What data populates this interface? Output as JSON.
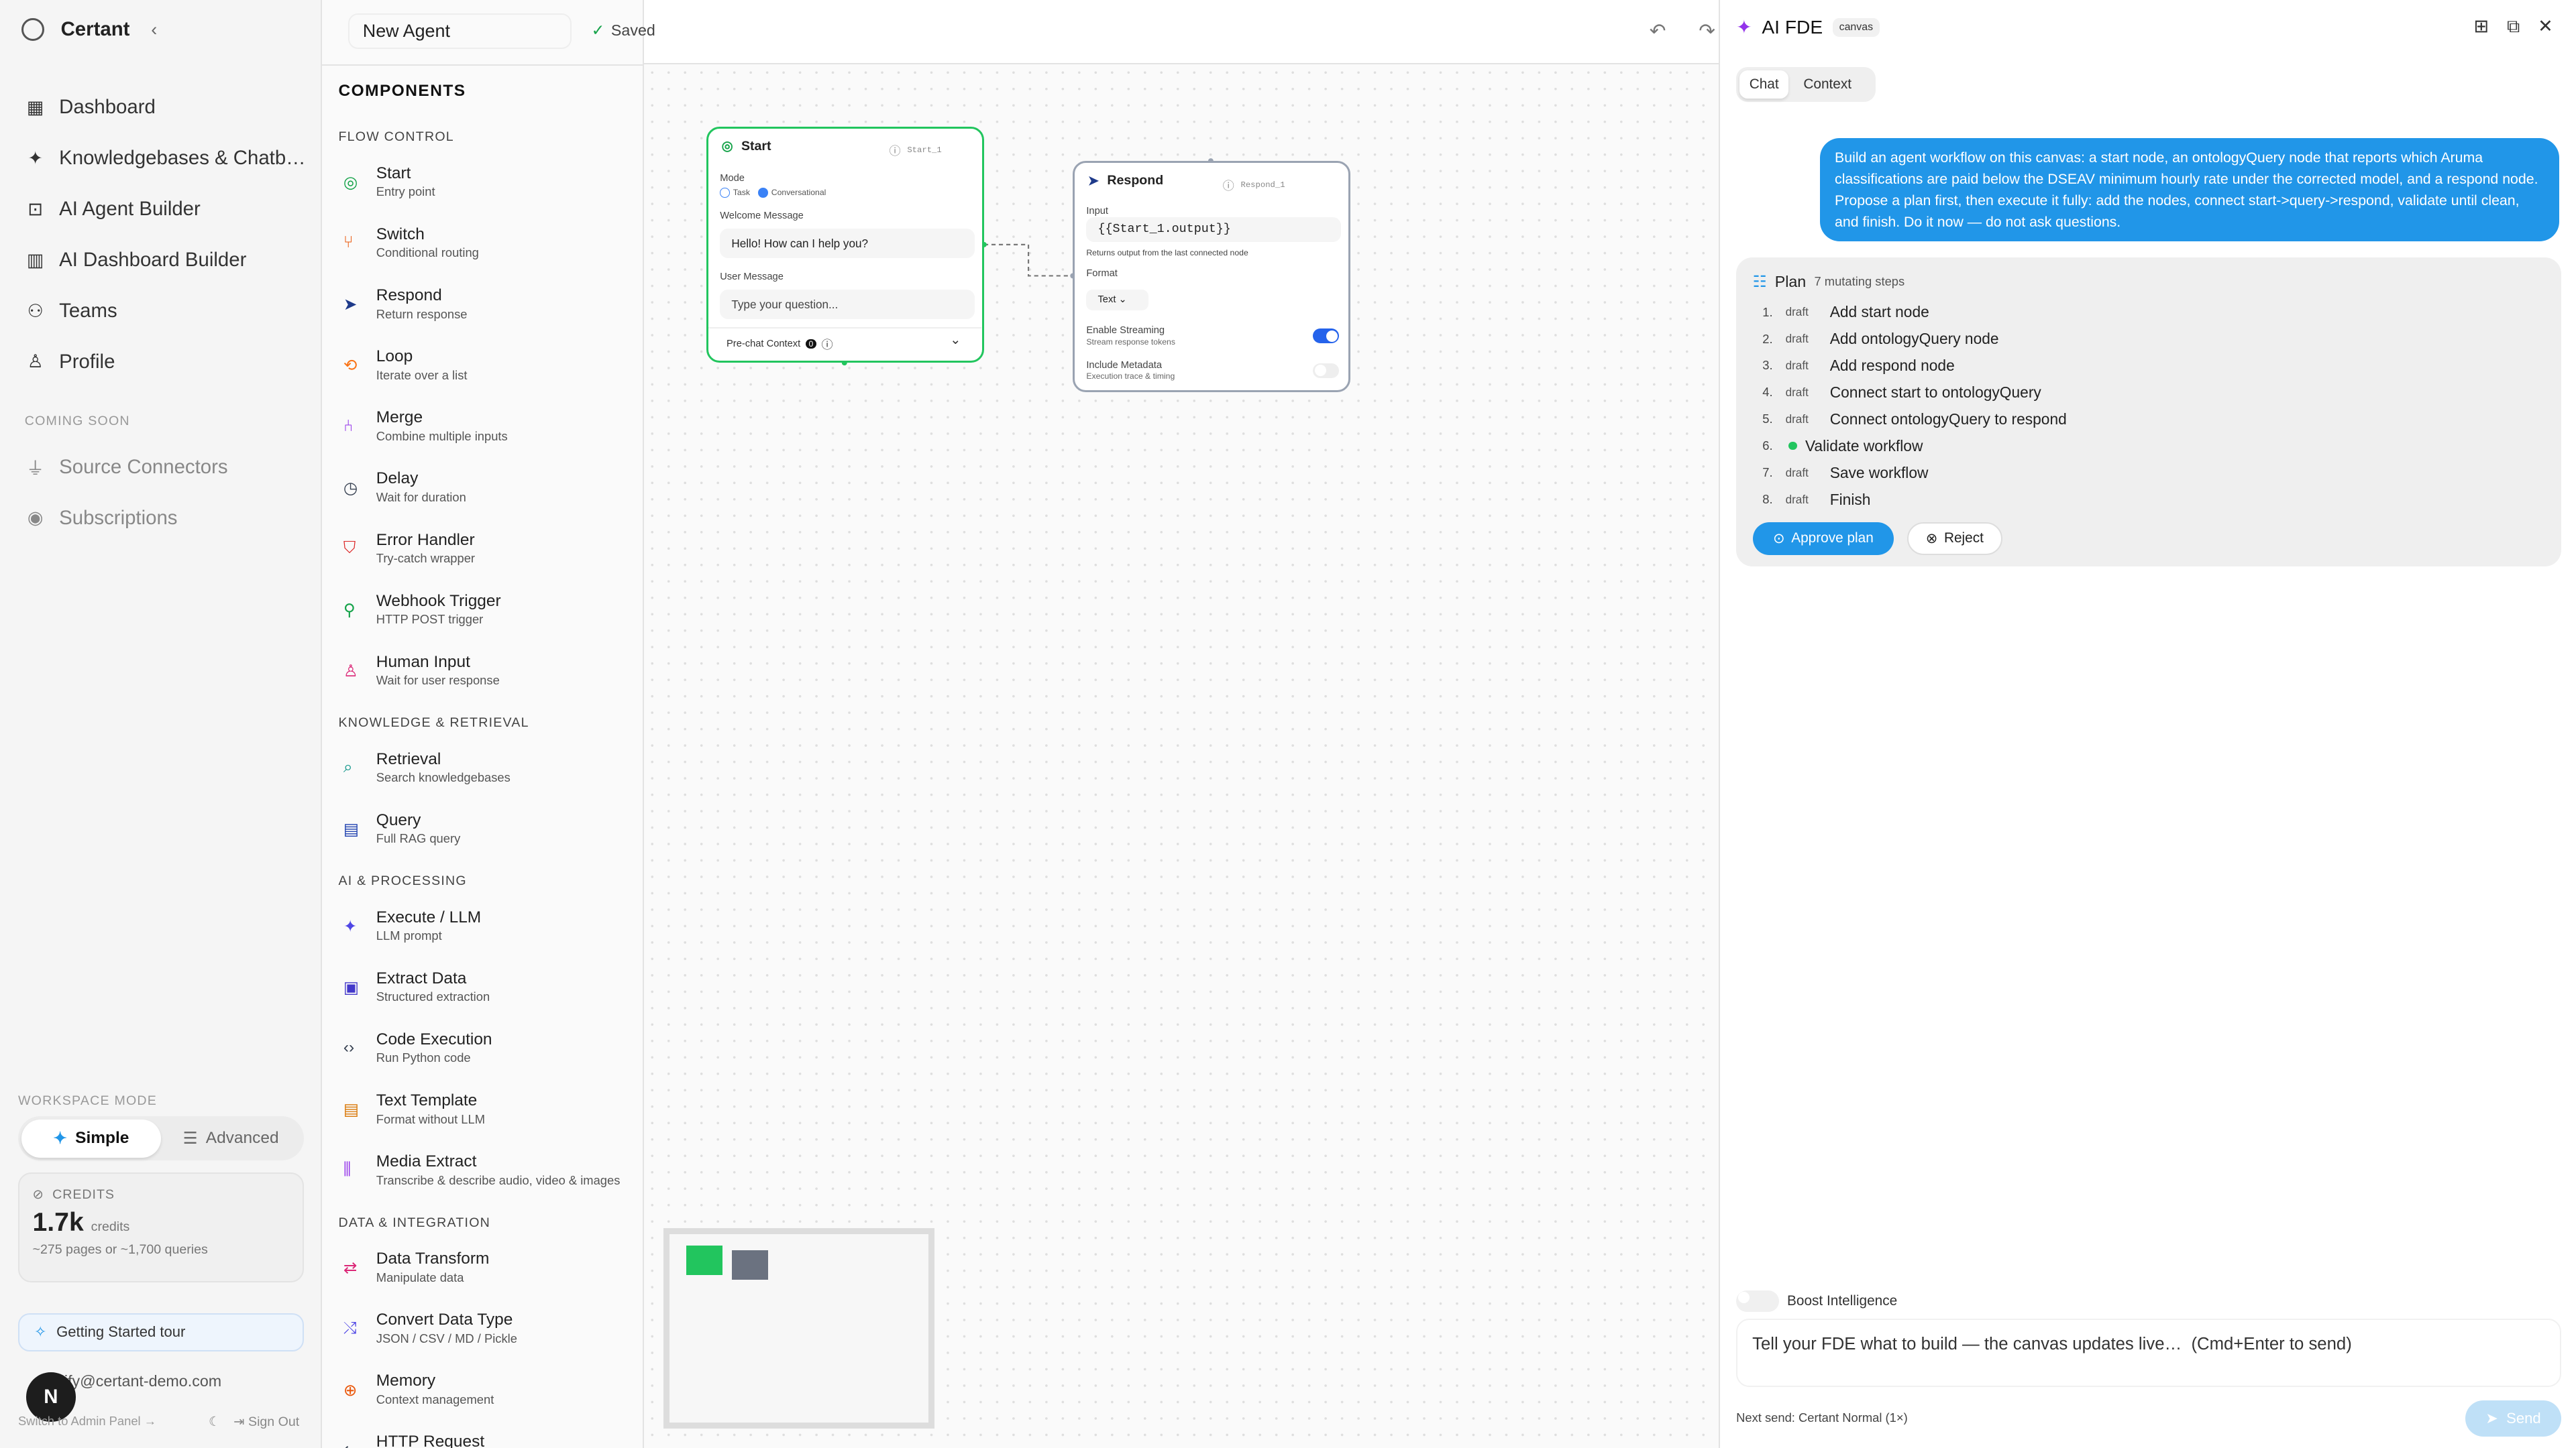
{
  "nav": {
    "brand": "Certant",
    "items": [
      {
        "label": "Dashboard",
        "icon": "dashboard-icon"
      },
      {
        "label": "Knowledgebases & Chatb…",
        "icon": "sparkle-icon"
      },
      {
        "label": "AI Agent Builder",
        "icon": "robot-icon"
      },
      {
        "label": "AI Dashboard Builder",
        "icon": "chart-icon"
      },
      {
        "label": "Teams",
        "icon": "users-icon"
      },
      {
        "label": "Profile",
        "icon": "user-icon"
      }
    ],
    "coming_soon_label": "COMING SOON",
    "coming_items": [
      {
        "label": "Source Connectors",
        "icon": "plug-icon"
      },
      {
        "label": "Subscriptions",
        "icon": "broadcast-icon"
      }
    ],
    "workspace_mode_label": "WORKSPACE MODE",
    "mode_simple": "Simple",
    "mode_advanced": "Advanced",
    "credits_label": "CREDITS",
    "credits_value": "1.7k",
    "credits_unit": "credits",
    "credits_sub": "~275 pages or ~1,700 queries",
    "tour_label": "Getting Started tour",
    "email": "rify@certant-demo.com",
    "avatar_letter": "N",
    "admin_link": "Switch to Admin Panel →",
    "signout": "Sign Out"
  },
  "components": {
    "title": "COMPONENTS",
    "sections": [
      {
        "label": "FLOW CONTROL",
        "items": [
          {
            "name": "Start",
            "desc": "Entry point",
            "color": "#16a34a"
          },
          {
            "name": "Switch",
            "desc": "Conditional routing",
            "color": "#ea580c"
          },
          {
            "name": "Respond",
            "desc": "Return response",
            "color": "#1e3a8a"
          },
          {
            "name": "Loop",
            "desc": "Iterate over a list",
            "color": "#f97316"
          },
          {
            "name": "Merge",
            "desc": "Combine multiple inputs",
            "color": "#9333ea"
          },
          {
            "name": "Delay",
            "desc": "Wait for duration",
            "color": "#374151"
          },
          {
            "name": "Error Handler",
            "desc": "Try-catch wrapper",
            "color": "#dc2626"
          },
          {
            "name": "Webhook Trigger",
            "desc": "HTTP POST trigger",
            "color": "#16a34a"
          },
          {
            "name": "Human Input",
            "desc": "Wait for user response",
            "color": "#db2777"
          }
        ]
      },
      {
        "label": "KNOWLEDGE & RETRIEVAL",
        "items": [
          {
            "name": "Retrieval",
            "desc": "Search knowledgebases",
            "color": "#0d9488"
          },
          {
            "name": "Query",
            "desc": "Full RAG query",
            "color": "#1e40af"
          }
        ]
      },
      {
        "label": "AI & PROCESSING",
        "items": [
          {
            "name": "Execute / LLM",
            "desc": "LLM prompt",
            "color": "#4f46e5"
          },
          {
            "name": "Extract Data",
            "desc": "Structured extraction",
            "color": "#4338ca"
          },
          {
            "name": "Code Execution",
            "desc": "Run Python code",
            "color": "#374151"
          },
          {
            "name": "Text Template",
            "desc": "Format without LLM",
            "color": "#d97706"
          },
          {
            "name": "Media Extract",
            "desc": "Transcribe & describe audio, video & images",
            "color": "#9333ea"
          }
        ]
      },
      {
        "label": "DATA & INTEGRATION",
        "items": [
          {
            "name": "Data Transform",
            "desc": "Manipulate data",
            "color": "#db2777"
          },
          {
            "name": "Convert Data Type",
            "desc": "JSON / CSV / MD / Pickle",
            "color": "#4f46e5"
          },
          {
            "name": "Memory",
            "desc": "Context management",
            "color": "#ea580c"
          },
          {
            "name": "HTTP Request",
            "desc": "",
            "color": "#374151"
          }
        ]
      }
    ]
  },
  "titlebar": {
    "name": "New Agent",
    "saved": "Saved"
  },
  "start_node": {
    "title": "Start",
    "id": "Start_1",
    "mode_label": "Mode",
    "mode_task": "Task",
    "mode_conv": "Conversational",
    "welcome_label": "Welcome Message",
    "welcome_value": "Hello! How can I help you?",
    "user_label": "User Message",
    "user_placeholder": "Type your question...",
    "prechat": "Pre-chat Context",
    "prechat_count": "0"
  },
  "respond_node": {
    "title": "Respond",
    "id": "Respond_1",
    "input_label": "Input",
    "input_value": "{{Start_1.output}}",
    "input_hint": "Returns output from the last connected node",
    "format_label": "Format",
    "format_value": "Text",
    "streaming_label": "Enable Streaming",
    "streaming_sub": "Stream response tokens",
    "metadata_label": "Include Metadata",
    "metadata_sub": "Execution trace & timing"
  },
  "fde": {
    "title": "AI FDE",
    "badge": "canvas",
    "tab_chat": "Chat",
    "tab_context": "Context",
    "message": "Build an agent workflow on this canvas: a start node, an ontologyQuery node that reports which Aruma classifications are paid below the DSEAV minimum hourly rate under the corrected model, and a respond node. Propose a plan first, then execute it fully: add the nodes, connect start->query->respond, validate until clean, and finish. Do it now — do not ask questions.",
    "plan_title": "Plan",
    "plan_sub": "7 mutating steps",
    "steps": [
      {
        "n": "1.",
        "status": "draft",
        "text": "Add start node"
      },
      {
        "n": "2.",
        "status": "draft",
        "text": "Add ontologyQuery node"
      },
      {
        "n": "3.",
        "status": "draft",
        "text": "Add respond node"
      },
      {
        "n": "4.",
        "status": "draft",
        "text": "Connect start to ontologyQuery"
      },
      {
        "n": "5.",
        "status": "draft",
        "text": "Connect ontologyQuery to respond"
      },
      {
        "n": "6.",
        "status": "",
        "text": "Validate workflow"
      },
      {
        "n": "7.",
        "status": "draft",
        "text": "Save workflow"
      },
      {
        "n": "8.",
        "status": "draft",
        "text": "Finish"
      }
    ],
    "approve": "Approve plan",
    "reject": "Reject",
    "boost": "Boost Intelligence",
    "composer_placeholder": "Tell your FDE what to build — the canvas updates live…  (Cmd+Enter to send)",
    "next_send": "Next send: Certant Normal (1×)",
    "send": "Send"
  }
}
